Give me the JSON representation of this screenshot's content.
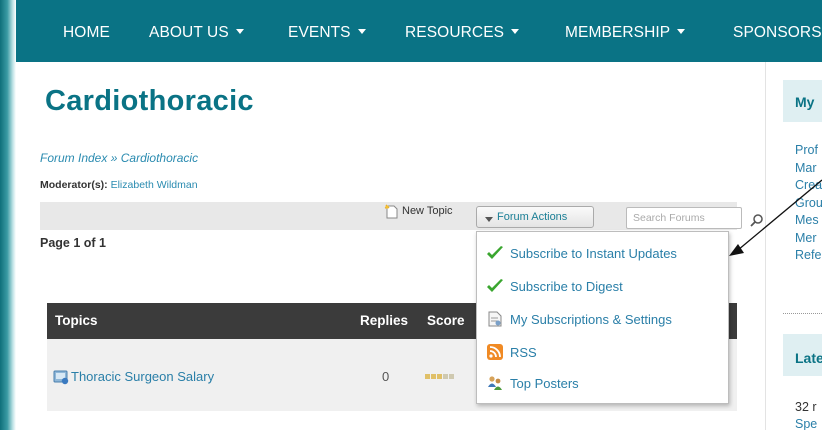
{
  "nav": {
    "items": [
      {
        "label": "HOME",
        "dropdown": false
      },
      {
        "label": "ABOUT US",
        "dropdown": true
      },
      {
        "label": "EVENTS",
        "dropdown": true
      },
      {
        "label": "RESOURCES",
        "dropdown": true
      },
      {
        "label": "MEMBERSHIP",
        "dropdown": true
      },
      {
        "label": "SPONSORS",
        "dropdown": false
      }
    ]
  },
  "page": {
    "title": "Cardiothoracic",
    "breadcrumb": {
      "root": "Forum Index",
      "separator": "»",
      "current": "Cardiothoracic"
    },
    "moderators": {
      "label": "Moderator(s):",
      "name": "Elizabeth Wildman"
    },
    "pagination": "Page 1 of 1"
  },
  "toolbar": {
    "new_topic": "New Topic",
    "forum_actions": "Forum Actions",
    "search_placeholder": "Search Forums"
  },
  "dropdown": {
    "items": [
      {
        "label": "Subscribe to Instant Updates",
        "icon": "checkmark-icon"
      },
      {
        "label": "Subscribe to Digest",
        "icon": "checkmark-icon"
      },
      {
        "label": "My Subscriptions & Settings",
        "icon": "document-icon"
      },
      {
        "label": "RSS",
        "icon": "rss-icon"
      },
      {
        "label": "Top Posters",
        "icon": "people-icon"
      }
    ]
  },
  "table": {
    "headers": [
      "Topics",
      "Replies",
      "Score"
    ],
    "rows": [
      {
        "topic": "Thoracic Surgeon Salary",
        "replies": "0",
        "score": 0
      }
    ]
  },
  "sidebar": {
    "box1_label": "My",
    "links": [
      "Prof",
      "Mar",
      "Crea",
      "Grou",
      "Mes",
      "Mer",
      "Refe"
    ],
    "box2_label": "Late",
    "text1": "32 r",
    "text2": "Spe"
  },
  "colors": {
    "nav_bg": "#0a7385",
    "title": "#0a7385",
    "link": "#2a7fa8",
    "table_header_bg": "#3b3b3b",
    "check_green": "#3aa62f"
  }
}
